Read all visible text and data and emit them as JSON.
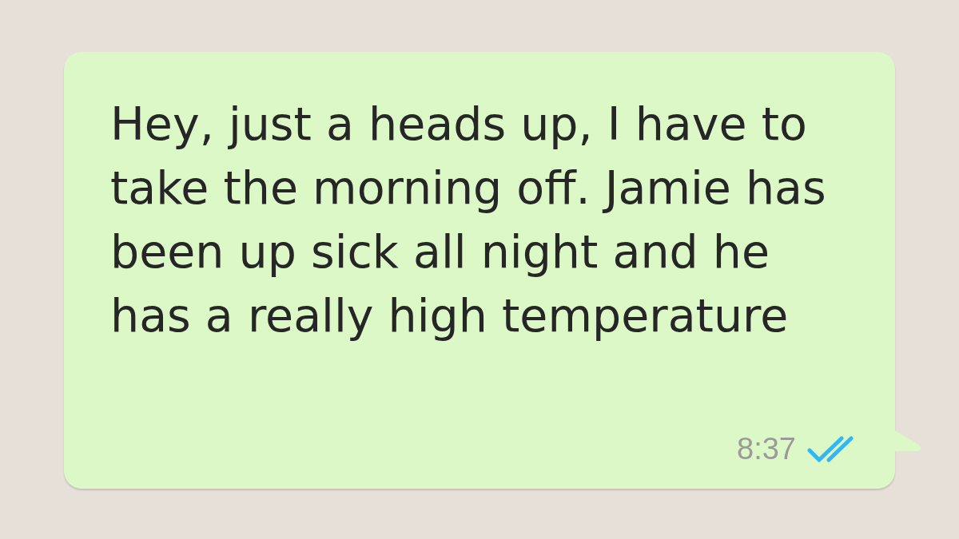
{
  "message": {
    "text": "Hey, just a heads up, I have to take the morning off. Jamie has been up sick all night and he has a really high temperature",
    "time": "8:37",
    "read": true
  }
}
